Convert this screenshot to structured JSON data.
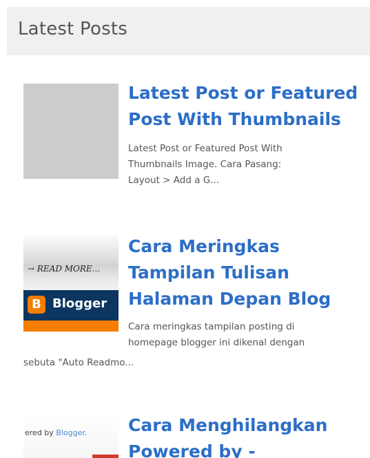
{
  "widget": {
    "title": "Latest Posts"
  },
  "posts": [
    {
      "title_lines": [
        "Latest Post or Featured",
        "Post With Thumbnails"
      ],
      "snippet_lines": [
        "Latest Post or Featured Post With",
        "Thumbnails  Image. Cara Pasang:",
        "Layout > Add a G..."
      ],
      "thumbnail": "gray-placeholder"
    },
    {
      "title_lines": [
        "Cara Meringkas",
        "Tampilan Tulisan",
        "Halaman Depan Blog"
      ],
      "snippet_lines": [
        "Cara meringkas tampilan posting di",
        "homepage blogger ini dikenal dengan",
        "sebuta \"Auto Readmo..."
      ],
      "thumbnail": "read-more-blogger-image",
      "thumbnail_text": {
        "read_more": "→ READ MORE...",
        "brand": "Blogger",
        "logo_letter": "B"
      }
    },
    {
      "title_lines": [
        "Cara Menghilangkan",
        "Powered by -"
      ],
      "thumbnail": "powered-by-blogger-image",
      "thumbnail_text": {
        "prefix": "ered by ",
        "brand": "Blogger."
      }
    }
  ],
  "colors": {
    "title_link": "#2d6ec7",
    "header_bg": "#f0f0f0",
    "header_text": "#555555",
    "snippet_text": "#555555",
    "placeholder": "#cccccc",
    "blogger_orange": "#f57d00",
    "blogger_navy": "#0c3560"
  }
}
